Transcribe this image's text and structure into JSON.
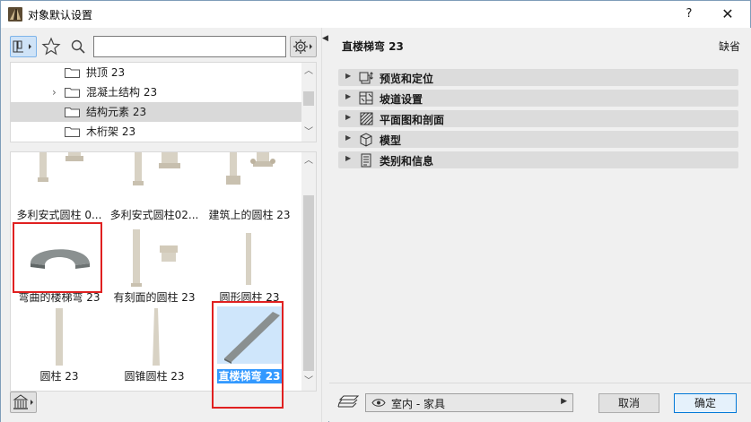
{
  "window": {
    "title": "对象默认设置",
    "help_label": "?",
    "close_label": "✕"
  },
  "search": {
    "value": "",
    "placeholder": ""
  },
  "tree": {
    "items": [
      {
        "label": "拱顶 23",
        "expandable": false,
        "selected": false
      },
      {
        "label": "混凝土结构 23",
        "expandable": true,
        "selected": false
      },
      {
        "label": "结构元素 23",
        "expandable": false,
        "selected": true
      },
      {
        "label": "木桁架 23",
        "expandable": false,
        "selected": false
      }
    ]
  },
  "objects": {
    "items": [
      {
        "label": "多利安式圆柱 0...",
        "icon": "column-doric-thumbnail"
      },
      {
        "label": "多利安式圆柱02...",
        "icon": "column-doric-thumbnail"
      },
      {
        "label": "建筑上的圆柱 23",
        "icon": "column-ionic-thumbnail"
      },
      {
        "label": "弯曲的楼梯弯 23",
        "icon": "curved-stair-thumbnail",
        "highlighted": true
      },
      {
        "label": "有刻面的圆柱 23",
        "icon": "faceted-column-thumbnail"
      },
      {
        "label": "圆形圆柱 23",
        "icon": "round-column-thumbnail"
      },
      {
        "label": "圆柱 23",
        "icon": "column-thumbnail"
      },
      {
        "label": "圆锥圆柱 23",
        "icon": "tapered-column-thumbnail"
      },
      {
        "label": "直楼梯弯 23",
        "icon": "straight-stair-thumbnail",
        "selected": true,
        "highlighted": true
      }
    ]
  },
  "details": {
    "object_name": "直楼梯弯 23",
    "default_label": "缺省",
    "sections": [
      {
        "label": "预览和定位",
        "icon": "preview-position-icon"
      },
      {
        "label": "坡道设置",
        "icon": "ramp-settings-icon"
      },
      {
        "label": "平面图和剖面",
        "icon": "floor-plan-section-icon"
      },
      {
        "label": "模型",
        "icon": "model-cube-icon"
      },
      {
        "label": "类别和信息",
        "icon": "category-info-icon"
      }
    ]
  },
  "footer": {
    "layer_value": "室内 - 家具",
    "cancel_label": "取消",
    "ok_label": "确定"
  },
  "colors": {
    "selection_blue": "#3399ff",
    "highlight_red": "#e02020",
    "primary_border": "#0078d7"
  }
}
